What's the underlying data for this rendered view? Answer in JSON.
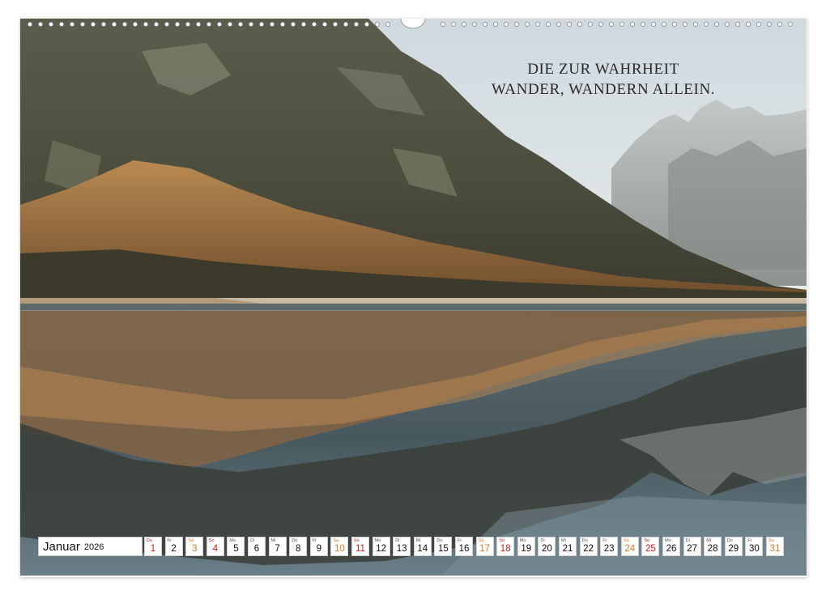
{
  "quote": {
    "line1": "DIE ZUR WAHRHEIT",
    "line2": "WANDER, WANDERN ALLEIN."
  },
  "calendar": {
    "month": "Januar",
    "year": "2026",
    "days": [
      {
        "wd": "Do",
        "num": "1",
        "style": "red"
      },
      {
        "wd": "Fr",
        "num": "2",
        "style": "normal"
      },
      {
        "wd": "Sa",
        "num": "3",
        "style": "orange"
      },
      {
        "wd": "So",
        "num": "4",
        "style": "red"
      },
      {
        "wd": "Mo",
        "num": "5",
        "style": "normal"
      },
      {
        "wd": "Di",
        "num": "6",
        "style": "normal"
      },
      {
        "wd": "Mi",
        "num": "7",
        "style": "normal"
      },
      {
        "wd": "Do",
        "num": "8",
        "style": "normal"
      },
      {
        "wd": "Fr",
        "num": "9",
        "style": "normal"
      },
      {
        "wd": "Sa",
        "num": "10",
        "style": "orange"
      },
      {
        "wd": "So",
        "num": "11",
        "style": "red"
      },
      {
        "wd": "Mo",
        "num": "12",
        "style": "normal"
      },
      {
        "wd": "Di",
        "num": "13",
        "style": "normal"
      },
      {
        "wd": "Mi",
        "num": "14",
        "style": "normal"
      },
      {
        "wd": "Do",
        "num": "15",
        "style": "normal"
      },
      {
        "wd": "Fr",
        "num": "16",
        "style": "normal"
      },
      {
        "wd": "Sa",
        "num": "17",
        "style": "orange"
      },
      {
        "wd": "So",
        "num": "18",
        "style": "red"
      },
      {
        "wd": "Mo",
        "num": "19",
        "style": "normal"
      },
      {
        "wd": "Di",
        "num": "20",
        "style": "normal"
      },
      {
        "wd": "Mi",
        "num": "21",
        "style": "normal"
      },
      {
        "wd": "Do",
        "num": "22",
        "style": "normal"
      },
      {
        "wd": "Fr",
        "num": "23",
        "style": "normal"
      },
      {
        "wd": "Sa",
        "num": "24",
        "style": "orange"
      },
      {
        "wd": "So",
        "num": "25",
        "style": "red"
      },
      {
        "wd": "Mo",
        "num": "26",
        "style": "normal"
      },
      {
        "wd": "Di",
        "num": "27",
        "style": "normal"
      },
      {
        "wd": "Mi",
        "num": "28",
        "style": "normal"
      },
      {
        "wd": "Do",
        "num": "29",
        "style": "normal"
      },
      {
        "wd": "Fr",
        "num": "30",
        "style": "normal"
      },
      {
        "wd": "Sa",
        "num": "31",
        "style": "orange"
      }
    ]
  },
  "colors": {
    "holiday": "#d01b1b",
    "saturday": "#e07a2a",
    "sky": "#dfe7ea",
    "water": "#4b5d66",
    "larch": "#c98a4e"
  }
}
